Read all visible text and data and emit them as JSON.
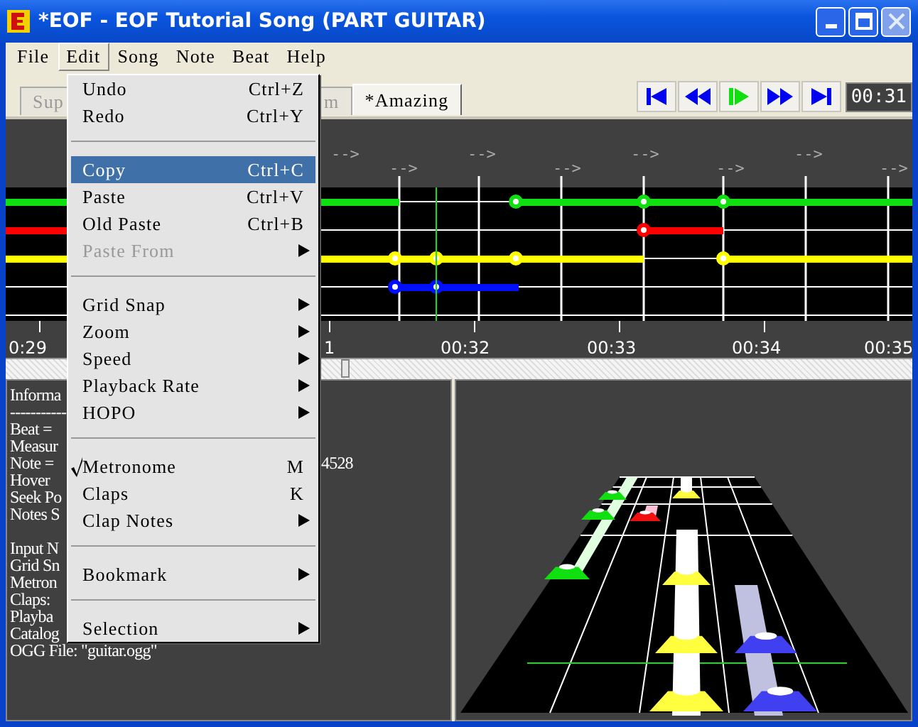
{
  "window": {
    "title": "*EOF - EOF Tutorial Song (PART GUITAR)"
  },
  "menu_bar": [
    {
      "label": "File",
      "selected": false
    },
    {
      "label": "Edit",
      "selected": true
    },
    {
      "label": "Song",
      "selected": false
    },
    {
      "label": "Note",
      "selected": false
    },
    {
      "label": "Beat",
      "selected": false
    },
    {
      "label": "Help",
      "selected": false
    }
  ],
  "tabs": [
    {
      "label": "Sup",
      "selected": false
    },
    {
      "label": "m",
      "selected": false
    },
    {
      "label": "*Amazing",
      "selected": true
    }
  ],
  "transport": {
    "time": "00:31"
  },
  "editor": {
    "beat_markers": [
      "-->",
      "-->",
      "-->",
      "-->",
      "-->",
      "-->",
      "-->",
      "-->"
    ],
    "time_labels": [
      "0:29",
      "1",
      "00:32",
      "00:33",
      "00:34",
      "00:35"
    ]
  },
  "info_panel": {
    "lines": [
      {
        "text": "Informa"
      },
      {
        "text": "-----------"
      },
      {
        "text": "Beat ="
      },
      {
        "text": "Measur"
      },
      {
        "text": "Note =",
        "tail": "4528"
      },
      {
        "text": "Hover"
      },
      {
        "text": "Seek Po"
      },
      {
        "text": "Notes S"
      },
      {
        "text": "Input N",
        "gap_before": true
      },
      {
        "text": "Grid Sn"
      },
      {
        "text": "Metron"
      },
      {
        "text": "Claps:"
      },
      {
        "text": "Playba"
      },
      {
        "text": "Catalog"
      },
      {
        "text": "OGG File: \"guitar.ogg\""
      }
    ]
  },
  "edit_menu": [
    {
      "kind": "item",
      "label": "Undo",
      "shortcut": "Ctrl+Z",
      "submenu": false,
      "disabled": false,
      "selected": false,
      "checked": false
    },
    {
      "kind": "item",
      "label": "Redo",
      "shortcut": "Ctrl+Y",
      "submenu": false,
      "disabled": false,
      "selected": false,
      "checked": false
    },
    {
      "kind": "separator"
    },
    {
      "kind": "item",
      "label": "Copy",
      "shortcut": "Ctrl+C",
      "submenu": false,
      "disabled": false,
      "selected": true,
      "checked": false
    },
    {
      "kind": "item",
      "label": "Paste",
      "shortcut": "Ctrl+V",
      "submenu": false,
      "disabled": false,
      "selected": false,
      "checked": false
    },
    {
      "kind": "item",
      "label": "Old Paste",
      "shortcut": "Ctrl+B",
      "submenu": false,
      "disabled": false,
      "selected": false,
      "checked": false
    },
    {
      "kind": "item",
      "label": "Paste From",
      "submenu": true,
      "disabled": true,
      "selected": false,
      "checked": false
    },
    {
      "kind": "separator"
    },
    {
      "kind": "item",
      "label": "Grid Snap",
      "submenu": true,
      "disabled": false,
      "selected": false,
      "checked": false
    },
    {
      "kind": "item",
      "label": "Zoom",
      "submenu": true,
      "disabled": false,
      "selected": false,
      "checked": false
    },
    {
      "kind": "item",
      "label": "Speed",
      "submenu": true,
      "disabled": false,
      "selected": false,
      "checked": false
    },
    {
      "kind": "item",
      "label": "Playback Rate",
      "submenu": true,
      "disabled": false,
      "selected": false,
      "checked": false
    },
    {
      "kind": "item",
      "label": "HOPO",
      "submenu": true,
      "disabled": false,
      "selected": false,
      "checked": false
    },
    {
      "kind": "separator"
    },
    {
      "kind": "item",
      "label": "Metronome",
      "shortcut": "M",
      "submenu": false,
      "disabled": false,
      "selected": false,
      "checked": true
    },
    {
      "kind": "item",
      "label": "Claps",
      "shortcut": "K",
      "submenu": false,
      "disabled": false,
      "selected": false,
      "checked": false
    },
    {
      "kind": "item",
      "label": "Clap Notes",
      "submenu": true,
      "disabled": false,
      "selected": false,
      "checked": false
    },
    {
      "kind": "separator"
    },
    {
      "kind": "item",
      "label": "Bookmark",
      "submenu": true,
      "disabled": false,
      "selected": false,
      "checked": false
    },
    {
      "kind": "separator"
    },
    {
      "kind": "item",
      "label": "Selection",
      "submenu": true,
      "disabled": false,
      "selected": false,
      "checked": false
    }
  ]
}
